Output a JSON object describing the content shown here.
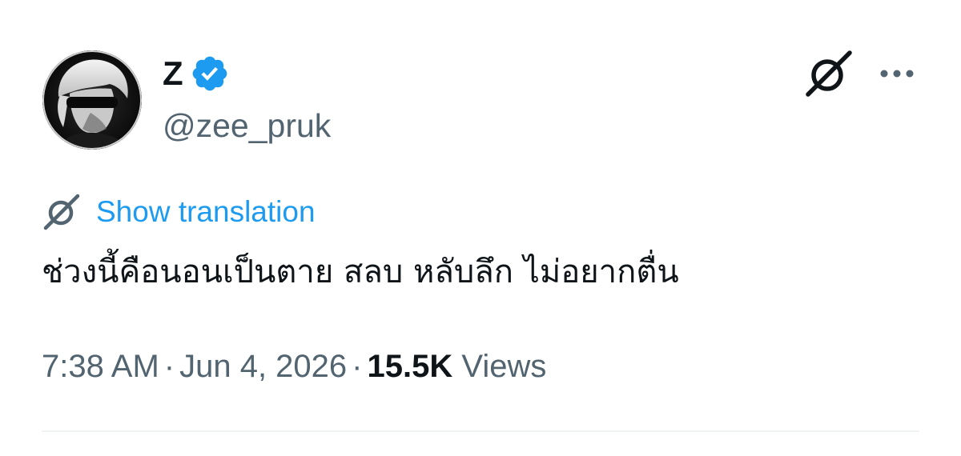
{
  "tweet": {
    "author": {
      "display_name": "Z",
      "handle": "@zee_pruk",
      "verified": true,
      "verified_icon": "verified-badge-icon",
      "avatar": "profile-avatar"
    },
    "actions": {
      "grok_icon": "grok-icon",
      "more_icon": "more-options-icon"
    },
    "translation": {
      "icon": "grok-icon",
      "label": "Show translation"
    },
    "text": "ช่วงนี้คือนอนเป็นตาย สลบ หลับลึก ไม่อยากตื่น",
    "meta": {
      "time": "7:38 AM",
      "separator": "·",
      "date": "Jun 4, 2026",
      "views_count": "15.5K",
      "views_label": "Views"
    }
  },
  "colors": {
    "text_primary": "#0f1419",
    "text_secondary": "#536471",
    "link": "#1d9bf0",
    "verified": "#1d9bf0",
    "divider": "#eff3f4"
  }
}
